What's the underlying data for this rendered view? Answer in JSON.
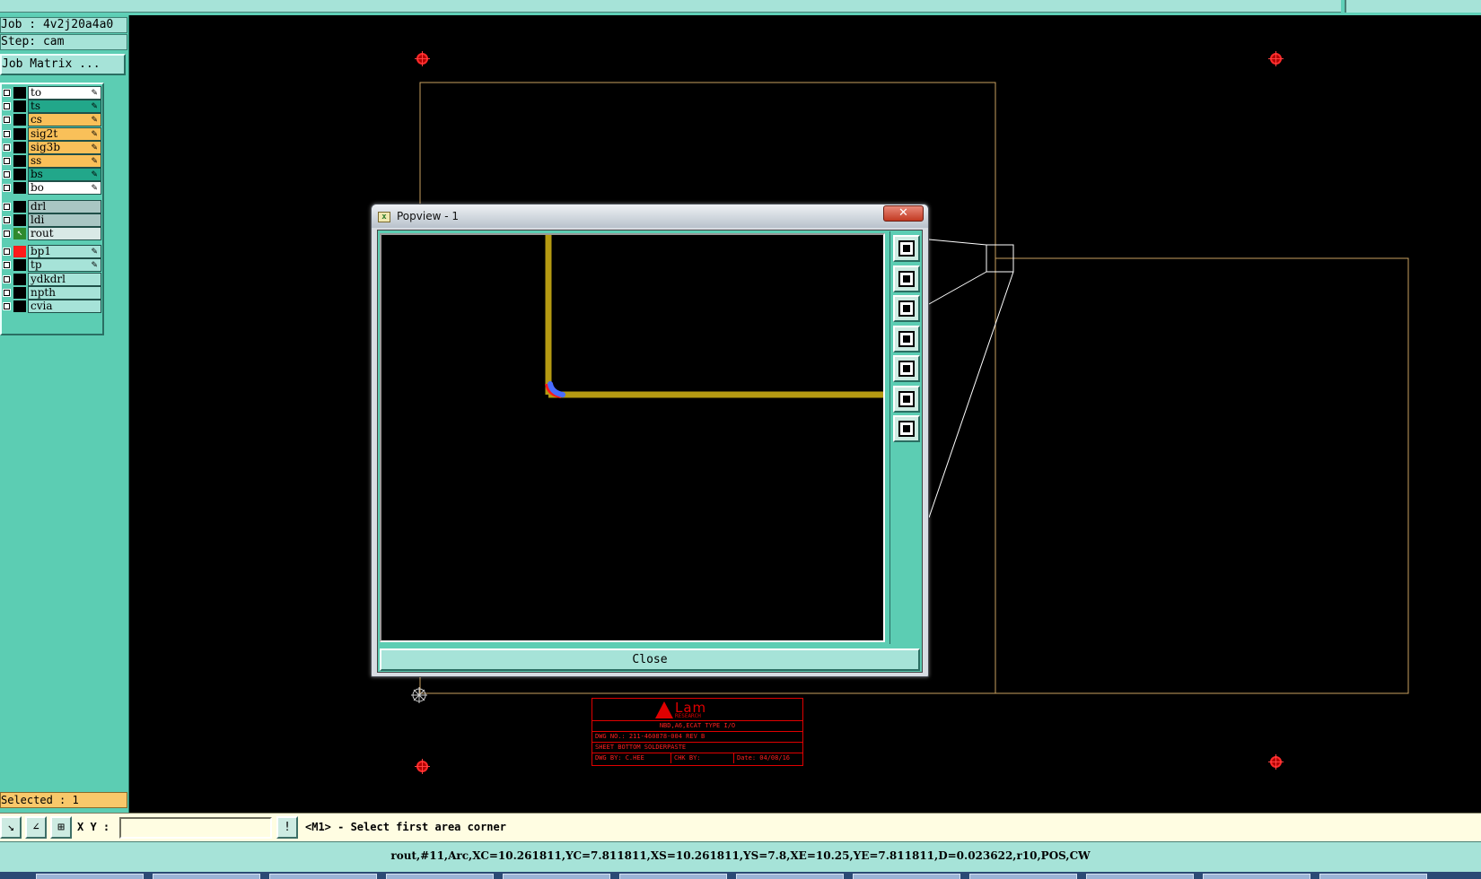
{
  "job_label": "Job : 4v2j20a4a0",
  "step_label": "Step: cam",
  "job_matrix_button": "Job Matrix ...",
  "layers": [
    {
      "name": "to",
      "color": "#ffffff",
      "pen": true,
      "marker": ""
    },
    {
      "name": "ts",
      "color": "#22a78a",
      "pen": true,
      "marker": ""
    },
    {
      "name": "cs",
      "color": "#f9c059",
      "pen": true,
      "marker": ""
    },
    {
      "name": "sig2t",
      "color": "#f9c059",
      "pen": true,
      "marker": ""
    },
    {
      "name": "sig3b",
      "color": "#f9c059",
      "pen": true,
      "marker": ""
    },
    {
      "name": "ss",
      "color": "#f9c059",
      "pen": true,
      "marker": ""
    },
    {
      "name": "bs",
      "color": "#22a78a",
      "pen": true,
      "marker": ""
    },
    {
      "name": "bo",
      "color": "#ffffff",
      "pen": true,
      "marker": ""
    },
    {
      "name": "drl",
      "color": "#a9c6c3",
      "pen": false,
      "marker": ""
    },
    {
      "name": "ldi",
      "color": "#a9c6c3",
      "pen": false,
      "marker": ""
    },
    {
      "name": "rout",
      "color": "#d9e9e6",
      "pen": false,
      "marker": "work"
    },
    {
      "name": "bp1",
      "color": "#a6e3d8",
      "pen": true,
      "marker": "red"
    },
    {
      "name": "tp",
      "color": "#a6e3d8",
      "pen": true,
      "marker": ""
    },
    {
      "name": "ydkdrl",
      "color": "#a6e3d8",
      "pen": false,
      "marker": ""
    },
    {
      "name": "npth",
      "color": "#a6e3d8",
      "pen": false,
      "marker": ""
    },
    {
      "name": "cvia",
      "color": "#a6e3d8",
      "pen": false,
      "marker": ""
    }
  ],
  "selected_label": "Selected : 1",
  "xy_label": "X Y :",
  "xy_value": "",
  "prompt_text": "<M1> - Select first area corner",
  "status_text": "rout,#11,Arc,XC=10.261811,YC=7.811811,XS=10.261811,YS=7.8,XE=10.25,YE=7.811811,D=0.023622,r10,POS,CW",
  "popview": {
    "title": "Popview - 1",
    "close_x": "✕",
    "close_button": "Close",
    "tools": [
      "zoom-fit-icon",
      "pan-up-icon",
      "pan-down-icon",
      "pan-left-icon",
      "pan-right-icon",
      "zoom-in-icon",
      "zoom-out-icon"
    ]
  },
  "title_block": {
    "brand": "Lam",
    "brand_sub": "RESEARCH",
    "line1": "NBD,A6,ECAT TYPE I/O",
    "line2": "DWG NO.:  211-460878-004 REV B",
    "line3": "SHEET     BOTTOM SOLDERPASTE",
    "cells": [
      "DWG BY: C.HEE",
      "CHK BY:",
      "Date: 04/08/16"
    ]
  },
  "colors": {
    "panel": "#5ccdb3",
    "panel_light": "#a6e3d8",
    "outline": "#c8a060",
    "trace": "#b59a12",
    "target": "#ff2a2a",
    "highlight": "#4a6cff"
  }
}
